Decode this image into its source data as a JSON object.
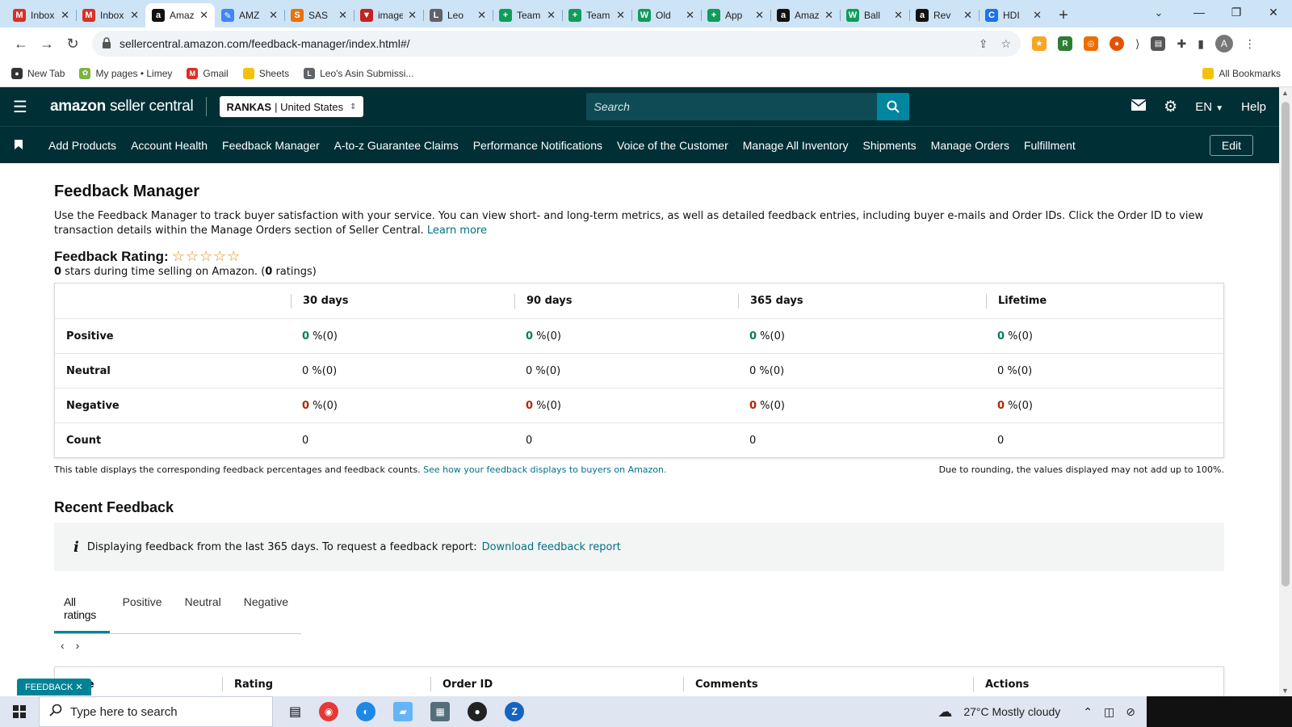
{
  "browser": {
    "tabs": [
      {
        "title": "Inbox",
        "icon": "gmail-icon",
        "color": "#d93025",
        "glyph": "M",
        "active": false
      },
      {
        "title": "Inbox",
        "icon": "gmail-icon",
        "color": "#d93025",
        "glyph": "M",
        "active": false
      },
      {
        "title": "Amazon",
        "icon": "amazon-icon",
        "color": "#111111",
        "glyph": "a",
        "active": true
      },
      {
        "title": "AMZ",
        "icon": "app-icon",
        "color": "#4285f4",
        "glyph": "✎",
        "active": false
      },
      {
        "title": "SAS",
        "icon": "sas-icon",
        "color": "#e8710a",
        "glyph": "S",
        "active": false
      },
      {
        "title": "images",
        "icon": "filter-icon",
        "color": "#c5221f",
        "glyph": "▼",
        "active": false
      },
      {
        "title": "Leo",
        "icon": "leo-icon",
        "color": "#5f6368",
        "glyph": "L",
        "active": false
      },
      {
        "title": "Team",
        "icon": "sheets-plus-icon",
        "color": "#0f9d58",
        "glyph": "+",
        "active": false
      },
      {
        "title": "Team",
        "icon": "sheets-plus-icon",
        "color": "#0f9d58",
        "glyph": "+",
        "active": false
      },
      {
        "title": "Old",
        "icon": "w-icon",
        "color": "#0f9d58",
        "glyph": "W",
        "active": false
      },
      {
        "title": "App",
        "icon": "sheets-plus-icon",
        "color": "#0f9d58",
        "glyph": "+",
        "active": false
      },
      {
        "title": "Amazon",
        "icon": "amazon-icon",
        "color": "#111111",
        "glyph": "a",
        "active": false
      },
      {
        "title": "Ball",
        "icon": "w-icon",
        "color": "#0f9d58",
        "glyph": "W",
        "active": false
      },
      {
        "title": "Rev",
        "icon": "amazon-icon",
        "color": "#111111",
        "glyph": "a",
        "active": false
      },
      {
        "title": "HDI",
        "icon": "c-icon",
        "color": "#1a73e8",
        "glyph": "C",
        "active": false
      }
    ],
    "url": "sellercentral.amazon.com/feedback-manager/index.html#/",
    "bookmarks": [
      {
        "label": "New Tab",
        "color": "#333333",
        "glyph": "●"
      },
      {
        "label": "My pages • Limey",
        "color": "#7cb342",
        "glyph": "✿"
      },
      {
        "label": "Gmail",
        "color": "#d93025",
        "glyph": "M"
      },
      {
        "label": "Sheets",
        "color": "#f4c20d",
        "glyph": ""
      },
      {
        "label": "Leo's Asin Submissi...",
        "color": "#5f6368",
        "glyph": "L"
      }
    ],
    "all_bookmarks": "All Bookmarks",
    "profile_initial": "A"
  },
  "header": {
    "logo_bold": "amazon",
    "logo_light": "seller central",
    "store_name": "RANKAS",
    "store_region": "| United States",
    "search_placeholder": "Search",
    "language": "EN",
    "help": "Help"
  },
  "nav": {
    "items": [
      "Add Products",
      "Account Health",
      "Feedback Manager",
      "A-to-z Guarantee Claims",
      "Performance Notifications",
      "Voice of the Customer",
      "Manage All Inventory",
      "Shipments",
      "Manage Orders",
      "Fulfillment"
    ],
    "edit": "Edit"
  },
  "page": {
    "title": "Feedback Manager",
    "description": "Use the Feedback Manager to track buyer satisfaction with your service. You can view short- and long-term metrics, as well as detailed feedback entries, including buyer e-mails and Order IDs. Click the Order ID to view transaction details within the Manage Orders section of Seller Central.",
    "learn_more": "Learn more",
    "rating_label": "Feedback Rating:",
    "stars_count": 0,
    "rating_sub_value": "0",
    "rating_sub_text": " stars during time selling on Amazon. (",
    "rating_sub_count": "0",
    "rating_sub_end": " ratings)"
  },
  "feedback_table": {
    "columns": [
      "30 days",
      "90 days",
      "365 days",
      "Lifetime"
    ],
    "rows": [
      {
        "label": "Positive",
        "kind": "pos",
        "cells": [
          {
            "num": "0",
            "rest": " %(0)"
          },
          {
            "num": "0",
            "rest": " %(0)"
          },
          {
            "num": "0",
            "rest": " %(0)"
          },
          {
            "num": "0",
            "rest": " %(0)"
          }
        ]
      },
      {
        "label": "Neutral",
        "kind": "neu",
        "cells": [
          {
            "num": "0",
            "rest": " %(0)"
          },
          {
            "num": "0",
            "rest": " %(0)"
          },
          {
            "num": "0",
            "rest": " %(0)"
          },
          {
            "num": "0",
            "rest": " %(0)"
          }
        ]
      },
      {
        "label": "Negative",
        "kind": "neg",
        "cells": [
          {
            "num": "0",
            "rest": " %(0)"
          },
          {
            "num": "0",
            "rest": " %(0)"
          },
          {
            "num": "0",
            "rest": " %(0)"
          },
          {
            "num": "0",
            "rest": " %(0)"
          }
        ]
      },
      {
        "label": "Count",
        "kind": "count",
        "cells": [
          {
            "num": "0",
            "rest": ""
          },
          {
            "num": "0",
            "rest": ""
          },
          {
            "num": "0",
            "rest": ""
          },
          {
            "num": "0",
            "rest": ""
          }
        ]
      }
    ],
    "note_left": "This table displays the corresponding feedback percentages and feedback counts.",
    "note_link": "See how your feedback displays to buyers on Amazon.",
    "note_right": "Due to rounding, the values displayed may not add up to 100%."
  },
  "recent": {
    "title": "Recent Feedback",
    "info_text": "Displaying feedback from the last 365 days. To request a feedback report:",
    "info_link": "Download feedback report",
    "tabs": [
      "All ratings",
      "Positive",
      "Neutral",
      "Negative"
    ],
    "columns": [
      "Date",
      "Rating",
      "Order ID",
      "Comments",
      "Actions"
    ]
  },
  "feedback_tag": "FEEDBACK ✕",
  "taskbar": {
    "search_placeholder": "Type here to search",
    "weather": "27°C  Mostly cloudy"
  },
  "colors": {
    "header_bg": "#002f36",
    "accent": "#008296",
    "link": "#007185",
    "positive": "#067d62",
    "negative": "#b12704"
  }
}
